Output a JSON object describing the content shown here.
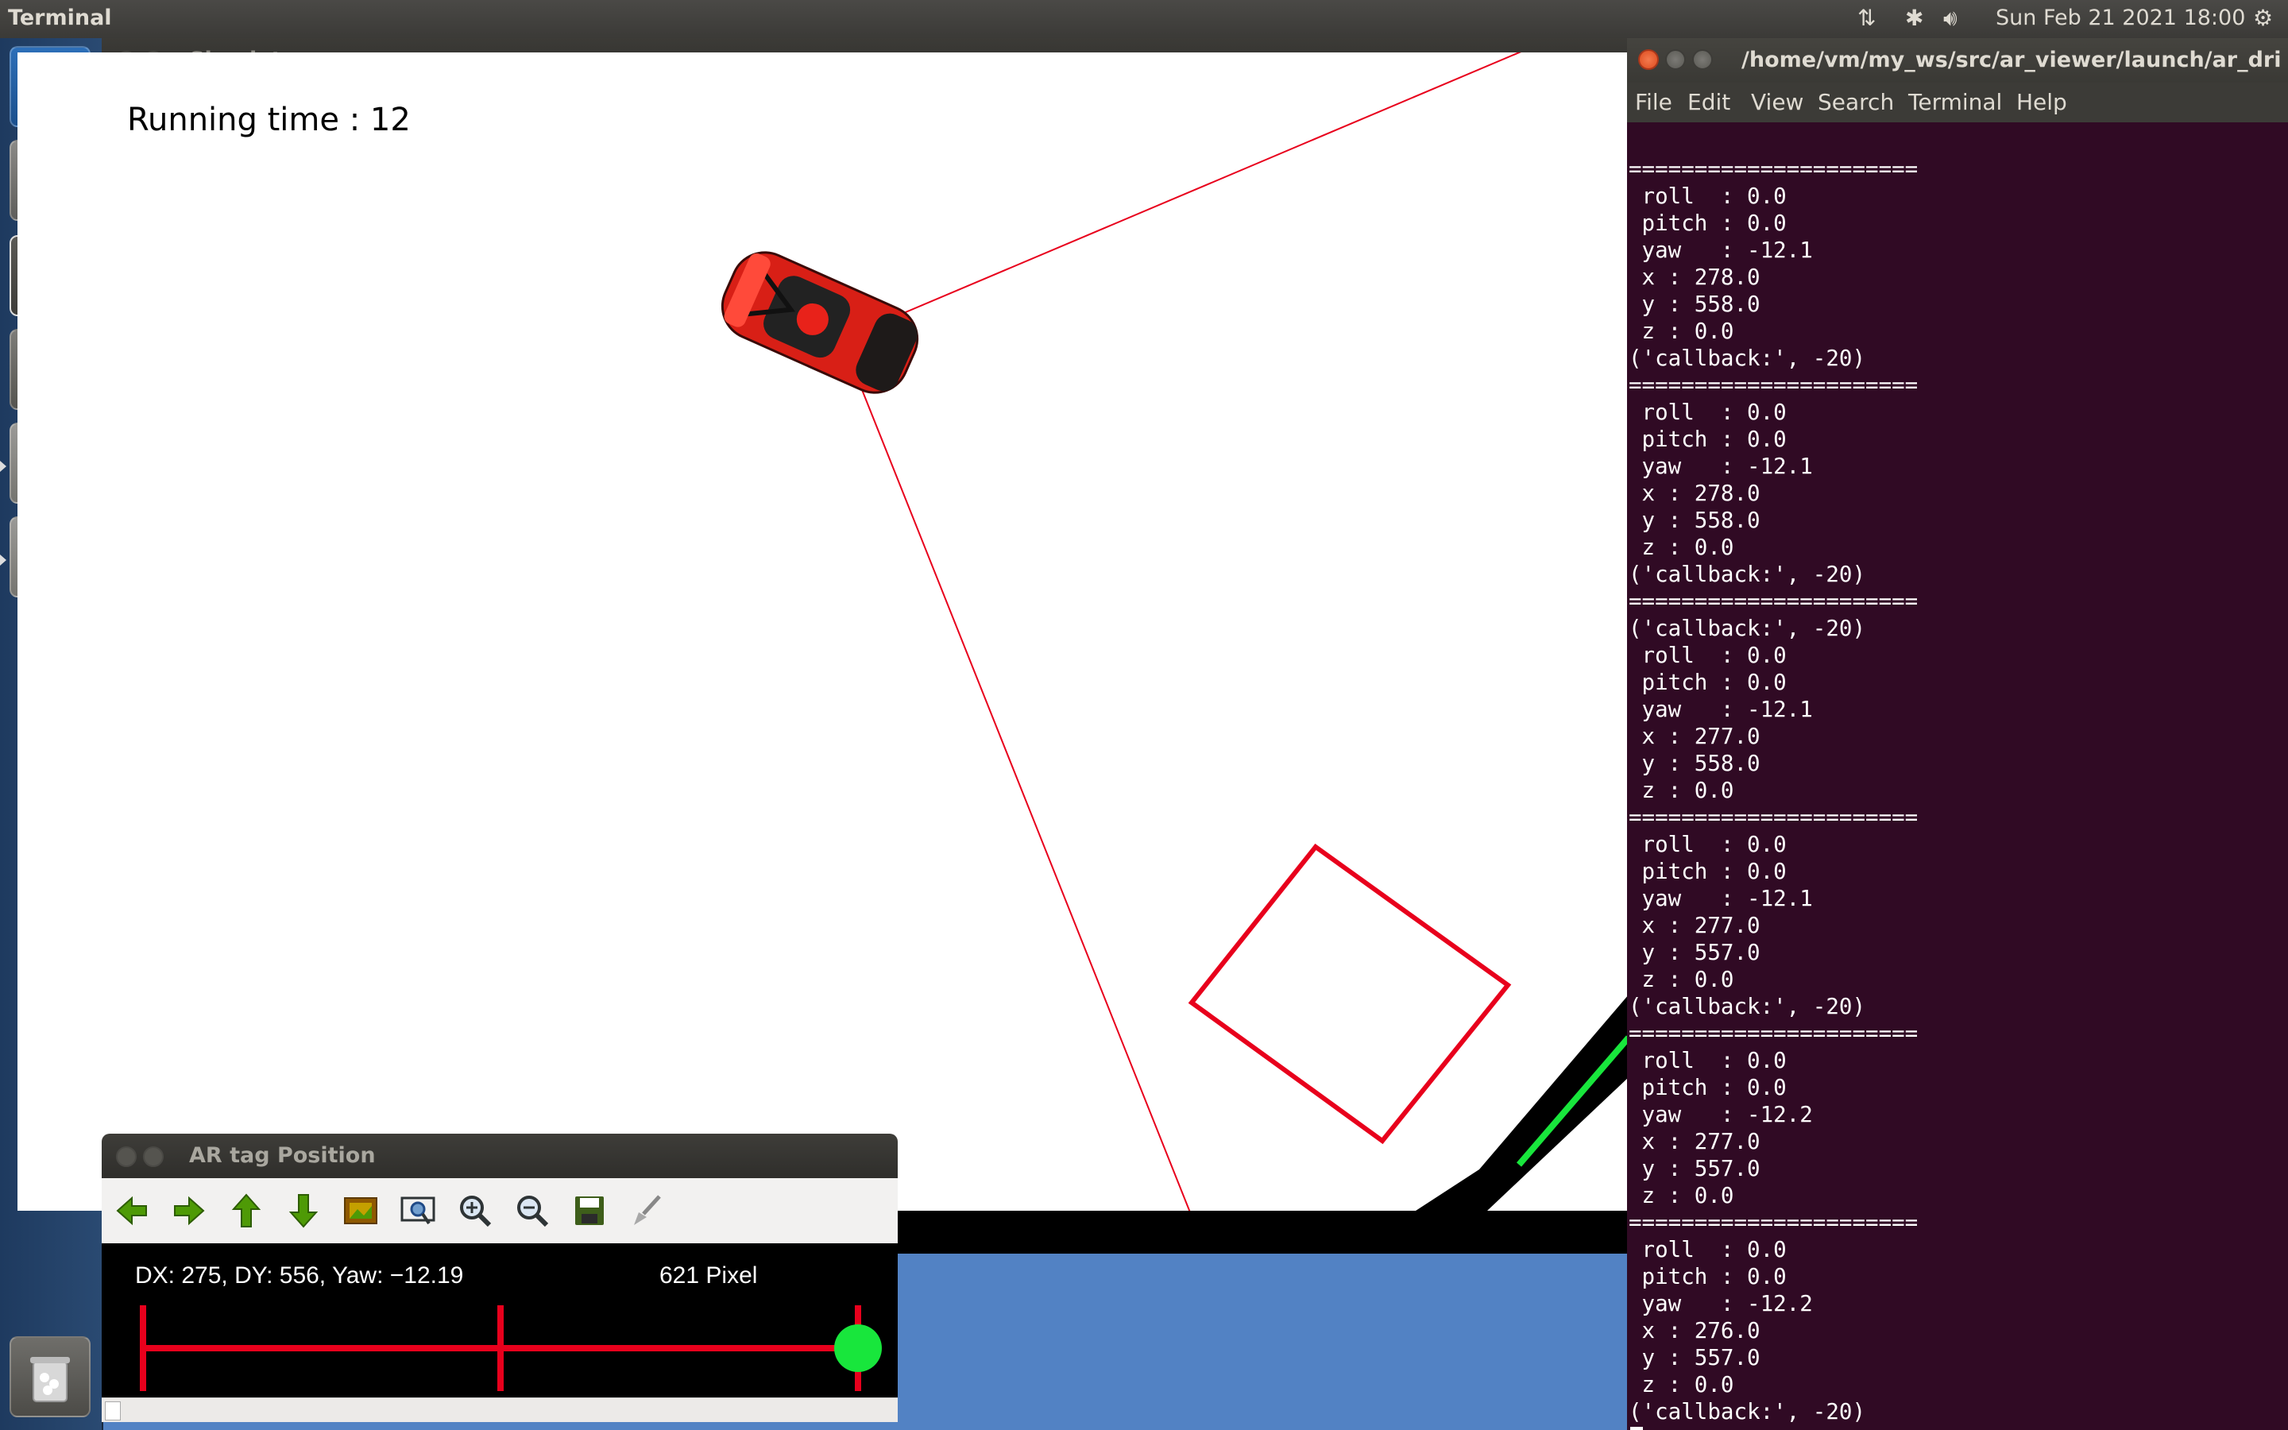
{
  "topbar": {
    "app_name": "Terminal",
    "datetime": "Sun Feb 21 2021 18:00",
    "indicators": [
      "network-icon",
      "bluetooth-icon",
      "volume-icon",
      "settings-gear-icon"
    ]
  },
  "launcher": {
    "items": [
      "ubuntu-dash-icon",
      "files-icon",
      "terminal-icon",
      "system-settings-icon",
      "unknown-app-icon",
      "unknown-app-icon",
      "trash-icon"
    ]
  },
  "simulator": {
    "title": "Simulator",
    "running_time": "Running time : 12"
  },
  "terminal": {
    "title": "/home/vm/my_ws/src/ar_viewer/launch/ar_dri",
    "menu": [
      "File",
      "Edit",
      "View",
      "Search",
      "Terminal",
      "Help"
    ],
    "lines": [
      "======================",
      " roll  : 0.0",
      " pitch : 0.0",
      " yaw   : -12.1",
      " x : 278.0",
      " y : 558.0",
      " z : 0.0",
      "('callback:', -20)",
      "======================",
      " roll  : 0.0",
      " pitch : 0.0",
      " yaw   : -12.1",
      " x : 278.0",
      " y : 558.0",
      " z : 0.0",
      "('callback:', -20)",
      "======================",
      "('callback:', -20)",
      " roll  : 0.0",
      " pitch : 0.0",
      " yaw   : -12.1",
      " x : 277.0",
      " y : 558.0",
      " z : 0.0",
      "======================",
      " roll  : 0.0",
      " pitch : 0.0",
      " yaw   : -12.1",
      " x : 277.0",
      " y : 557.0",
      " z : 0.0",
      "('callback:', -20)",
      "======================",
      " roll  : 0.0",
      " pitch : 0.0",
      " yaw   : -12.2",
      " x : 277.0",
      " y : 557.0",
      " z : 0.0",
      "======================",
      " roll  : 0.0",
      " pitch : 0.0",
      " yaw   : -12.2",
      " x : 276.0",
      " y : 557.0",
      " z : 0.0",
      "('callback:', -20)"
    ]
  },
  "ar_window": {
    "title": "AR tag Position",
    "toolbar": [
      "arrow-left-icon",
      "arrow-right-icon",
      "arrow-up-icon",
      "arrow-down-icon",
      "image-icon",
      "zoom-fit-icon",
      "zoom-in-icon",
      "zoom-out-icon",
      "save-icon",
      "brush-icon"
    ],
    "readout": "DX: 275, DY: 556, Yaw: −12.19",
    "pixel_label": "621 Pixel"
  },
  "colors": {
    "terminal_bg": "#300a24",
    "accent_red": "#e8001c",
    "accent_green": "#18e63c",
    "desktop_blue": "#5282c4"
  }
}
